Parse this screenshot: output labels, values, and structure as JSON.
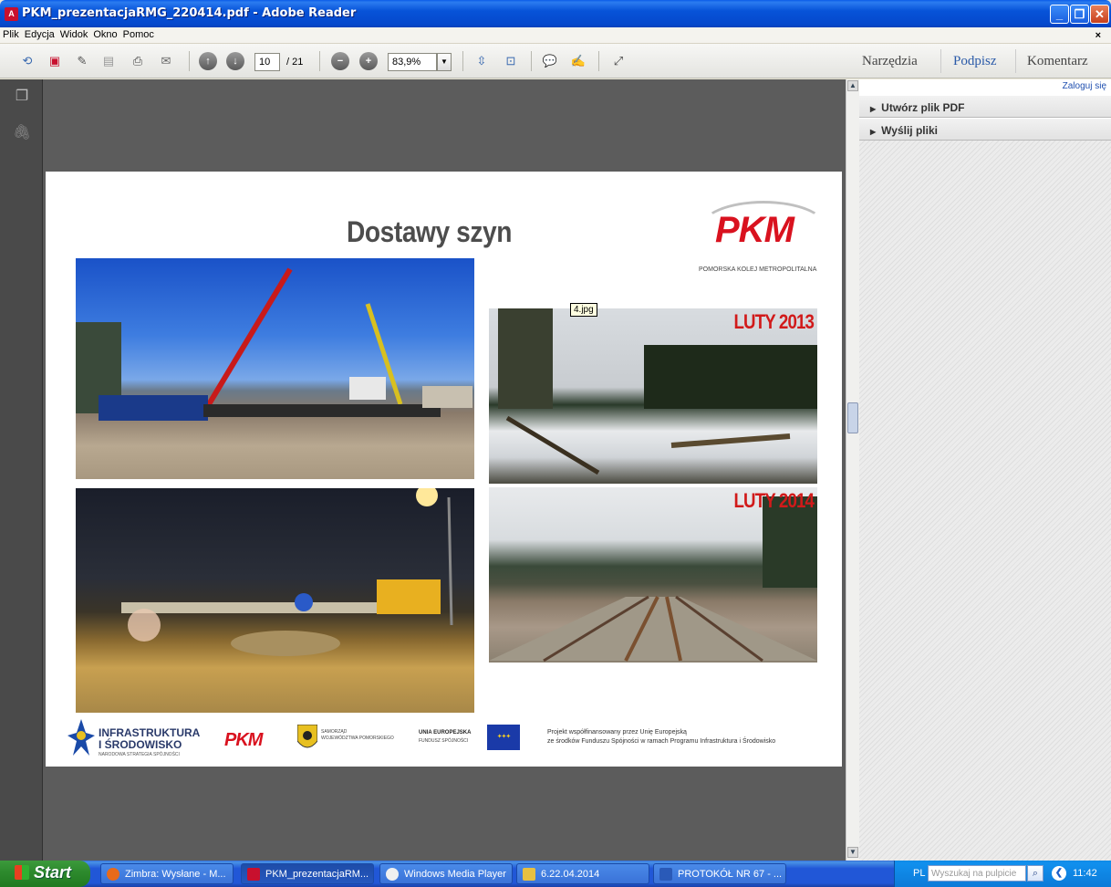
{
  "window": {
    "title": "PKM_prezentacjaRMG_220414.pdf - Adobe Reader",
    "app_icon": "adobe-reader-icon"
  },
  "menu": {
    "items": [
      "Plik",
      "Edycja",
      "Widok",
      "Okno",
      "Pomoc"
    ],
    "close": "×"
  },
  "toolbar": {
    "page_current": "10",
    "page_total": "/ 21",
    "zoom": "83,9%",
    "right_links": [
      "Narzędzia",
      "Podpisz",
      "Komentarz"
    ]
  },
  "right_panel": {
    "login": "Zaloguj się",
    "items": [
      "Utwórz plik PDF",
      "Wyślij pliki"
    ]
  },
  "slide": {
    "title": "Dostawy szyn",
    "logo_word": "PKM",
    "logo_sub": "POMORSKA KOLEJ METROPOLITALNA",
    "photo_label_1": "LUTY 2013",
    "photo_label_2": "LUTY 2014",
    "tooltip": "4.jpg",
    "footer": {
      "infra_line1": "INFRASTRUKTURA",
      "infra_line2": "I ŚRODOWISKO",
      "infra_line3": "NARODOWA STRATEGIA SPÓJNOŚCI",
      "pkm": "PKM",
      "samorzad_line1": "SAMORZĄD",
      "samorzad_line2": "WOJEWÓDZTWA POMORSKIEGO",
      "ue_line1": "UNIA EUROPEJSKA",
      "ue_line2": "FUNDUSZ SPÓJNOŚCI",
      "project_line1": "Projekt współfinansowany przez Unię Europejską",
      "project_line2": "ze środków Funduszu Spójności w ramach Programu Infrastruktura i Środowisko"
    }
  },
  "taskbar": {
    "start": "Start",
    "tasks": [
      "Zimbra: Wysłane - M...",
      "PKM_prezentacjaRM...",
      "Windows Media Player",
      "6.22.04.2014",
      "PROTOKÓŁ NR 67 - ..."
    ],
    "lang": "PL",
    "search_placeholder": "Wyszukaj na pulpicie",
    "clock": "11:42"
  },
  "colors": {
    "accent_red": "#d11a1a",
    "titlebar_blue": "#0753d8",
    "start_green": "#2e8b2e"
  }
}
